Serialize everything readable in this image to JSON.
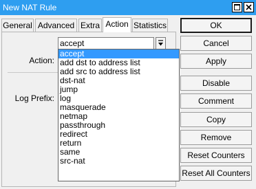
{
  "window": {
    "title": "New NAT Rule"
  },
  "tabs": [
    {
      "label": "General"
    },
    {
      "label": "Advanced"
    },
    {
      "label": "Extra"
    },
    {
      "label": "Action"
    },
    {
      "label": "Statistics"
    }
  ],
  "active_tab": "Action",
  "form": {
    "action_label": "Action:",
    "action_value": "accept",
    "log_prefix_label": "Log Prefix:"
  },
  "dropdown_options": [
    "accept",
    "add dst to address list",
    "add src to address list",
    "dst-nat",
    "jump",
    "log",
    "masquerade",
    "netmap",
    "passthrough",
    "redirect",
    "return",
    "same",
    "src-nat"
  ],
  "dropdown_selected": "accept",
  "buttons": {
    "ok": "OK",
    "cancel": "Cancel",
    "apply": "Apply",
    "disable": "Disable",
    "comment": "Comment",
    "copy": "Copy",
    "remove": "Remove",
    "reset_counters": "Reset Counters",
    "reset_all_counters": "Reset All Counters"
  },
  "colors": {
    "titlebar": "#2e9ef0",
    "selection": "#3399ff",
    "window_bg": "#f0f0f0"
  }
}
